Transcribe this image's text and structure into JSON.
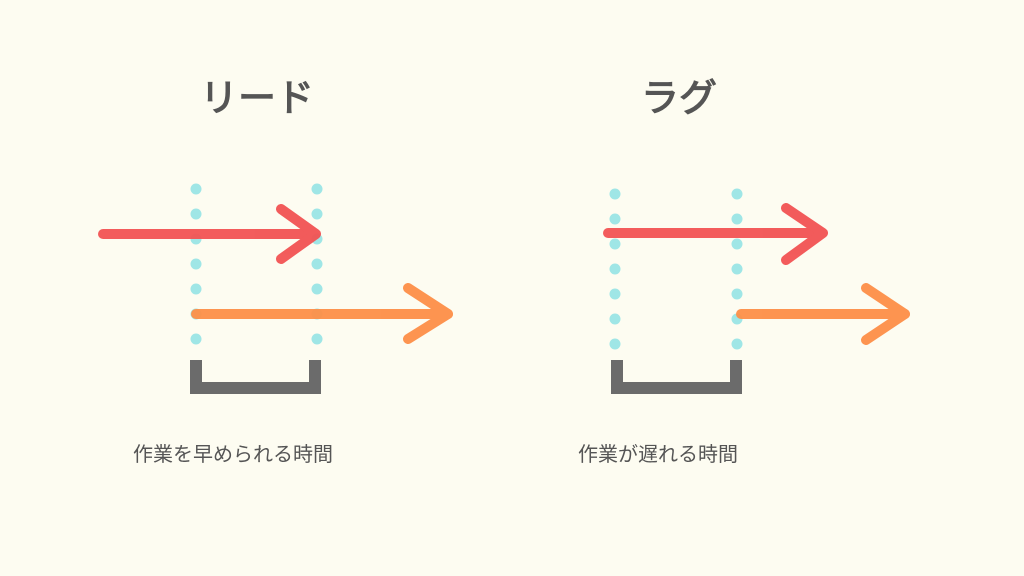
{
  "colors": {
    "background": "#fdfcf1",
    "text": "#555555",
    "bracket": "#6b6b6b",
    "dots": "#9fe6e6",
    "red_arrow": "#f25353",
    "orange_arrow": "#fd8f48"
  },
  "lead": {
    "title": "リード",
    "caption": "作業を早められる時間"
  },
  "lag": {
    "title": "ラグ",
    "caption": "作業が遅れる時間"
  }
}
